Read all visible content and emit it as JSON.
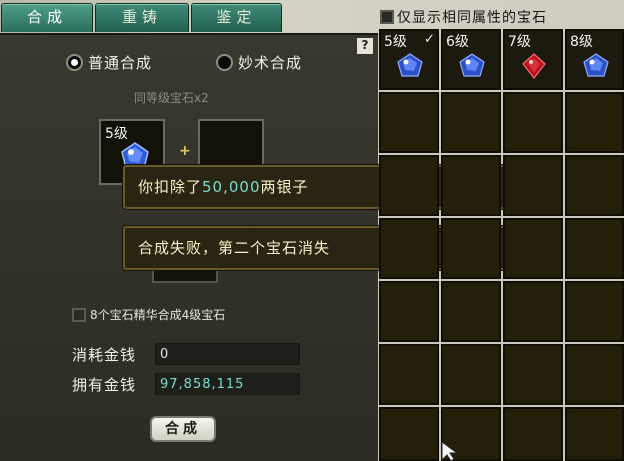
{
  "tabs": [
    {
      "label": "合成",
      "active": true
    },
    {
      "label": "重铸",
      "active": false
    },
    {
      "label": "鉴定",
      "active": false
    }
  ],
  "filter_label": "仅显示相同属性的宝石",
  "help_label": "?",
  "modes": [
    {
      "label": "普通合成",
      "selected": true
    },
    {
      "label": "妙术合成",
      "selected": false
    }
  ],
  "subtitle": "同等级宝石x2",
  "slot1_level": "5级",
  "plus_sign": "+",
  "toasts": [
    {
      "prefix": "你扣除了",
      "amount": "50,000",
      "suffix": "两银子"
    },
    {
      "text": "合成失败，第二个宝石消失"
    }
  ],
  "essence_label": "8个宝石精华合成4级宝石",
  "cost_label": "消耗金钱",
  "cost_value": "0",
  "owned_label": "拥有金钱",
  "owned_value": "97,858,115",
  "merge_button": "合成",
  "gem_cells": [
    {
      "level": "5级",
      "gem": "blue",
      "check": "✓"
    },
    {
      "level": "6级",
      "gem": "blue",
      "check": ""
    },
    {
      "level": "7级",
      "gem": "red",
      "check": ""
    },
    {
      "level": "8级",
      "gem": "blue",
      "check": ""
    }
  ],
  "colors": {
    "accent_text": "#79ddd0",
    "tab": "#2c6f5c",
    "toast_border": "#6a5a2a"
  }
}
